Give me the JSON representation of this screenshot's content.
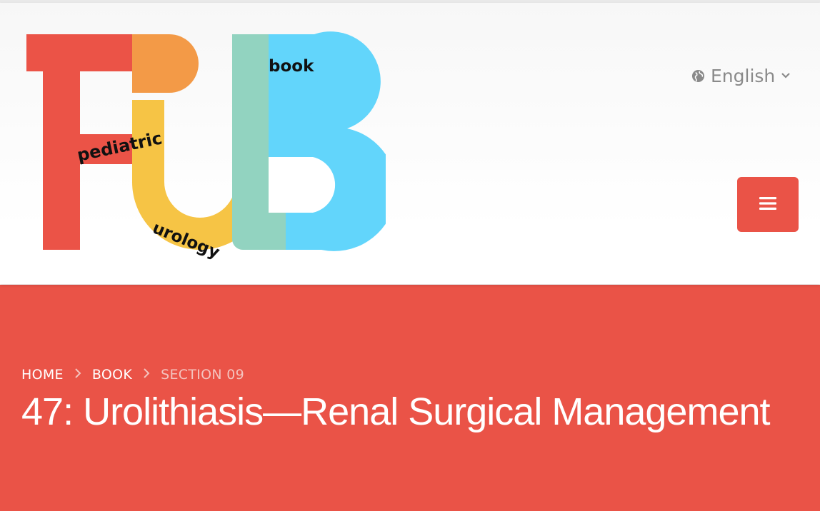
{
  "logo": {
    "letters": [
      "P",
      "U",
      "B"
    ],
    "words": [
      "pediatric",
      "urology",
      "book"
    ],
    "colors": {
      "red": "#eb5347",
      "orange": "#f39a47",
      "yellow": "#f6c445",
      "teal": "#92d3c0",
      "blue": "#62d5fb"
    }
  },
  "language": {
    "label": "English",
    "icon": "globe-icon",
    "caret_icon": "chevron-down-icon"
  },
  "menu": {
    "icon": "hamburger-icon",
    "color": "#ea5347"
  },
  "breadcrumb": {
    "items": [
      "HOME",
      "BOOK",
      "SECTION 09"
    ],
    "separator_icon": "chevron-right-icon"
  },
  "page": {
    "title": "47: Urolithiasis—Renal Surgical Management",
    "hero_color": "#ea5347"
  }
}
